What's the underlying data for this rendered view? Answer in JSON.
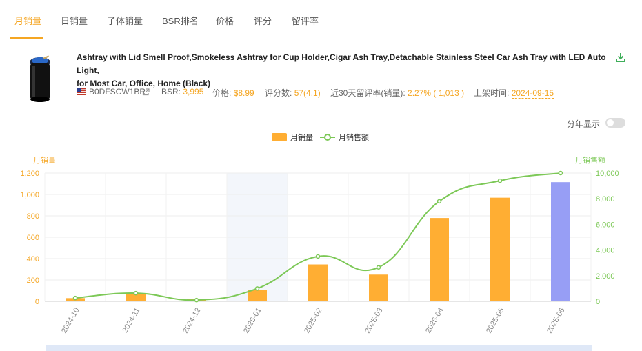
{
  "tabs": [
    {
      "label": "月销量",
      "active": true
    },
    {
      "label": "日销量",
      "active": false
    },
    {
      "label": "子体销量",
      "active": false
    },
    {
      "label": "BSR排名",
      "active": false
    },
    {
      "label": "价格",
      "active": false
    },
    {
      "label": "评分",
      "active": false
    },
    {
      "label": "留评率",
      "active": false
    }
  ],
  "product": {
    "title_line1": "Ashtray with Lid Smell Proof,Smokeless Ashtray for Cup Holder,Cigar Ash Tray,Detachable Stainless Steel Car Ash Tray with LED Auto Light,",
    "title_line2": "for Most Car, Office, Home (Black)",
    "asin": "B0DFSCW1BR",
    "bsr_label": "BSR:",
    "bsr_value": "3,995",
    "price_label": "价格:",
    "price_value": "$8.99",
    "rating_label": "评分数:",
    "rating_value": "57(4.1)",
    "review_rate_label": "近30天留评率(销量):",
    "review_rate_value": "2.27% ( 1,013 )",
    "listed_label": "上架时间:",
    "listed_value": "2024-09-15"
  },
  "toggle": {
    "label": "分年显示",
    "on": false
  },
  "colors": {
    "accent": "#f5a623",
    "bar": "#ffae33",
    "bar_highlight": "#979ef5",
    "line": "#7cc856",
    "hover_band": "#f3f6fb"
  },
  "chart_data": {
    "type": "bar",
    "categories": [
      "2024-10",
      "2024-11",
      "2024-12",
      "2025-01",
      "2025-02",
      "2025-03",
      "2025-04",
      "2025-05",
      "2025-06"
    ],
    "series": [
      {
        "name": "月销量",
        "type": "bar",
        "axis": "left",
        "values": [
          30,
          70,
          20,
          105,
          345,
          250,
          780,
          970,
          1115
        ]
      },
      {
        "name": "月销售额",
        "type": "line",
        "axis": "right",
        "values": [
          260,
          640,
          100,
          1000,
          3500,
          2650,
          7800,
          9400,
          10000
        ]
      }
    ],
    "ylabel_left": "月销量",
    "ylabel_right": "月销售额",
    "yticks_left": [
      "1,200",
      "1,000",
      "800",
      "600",
      "400",
      "200",
      "0"
    ],
    "yticks_right": [
      "10,000",
      "8,000",
      "6,000",
      "4,000",
      "2,000",
      "0"
    ],
    "ylim_left": [
      0,
      1200
    ],
    "ylim_right": [
      0,
      10000
    ],
    "legend": [
      "月销量",
      "月销售额"
    ],
    "legend_position": "top-center",
    "highlighted_category": "2025-01",
    "highlighted_bar": "2025-06",
    "grid": true
  }
}
